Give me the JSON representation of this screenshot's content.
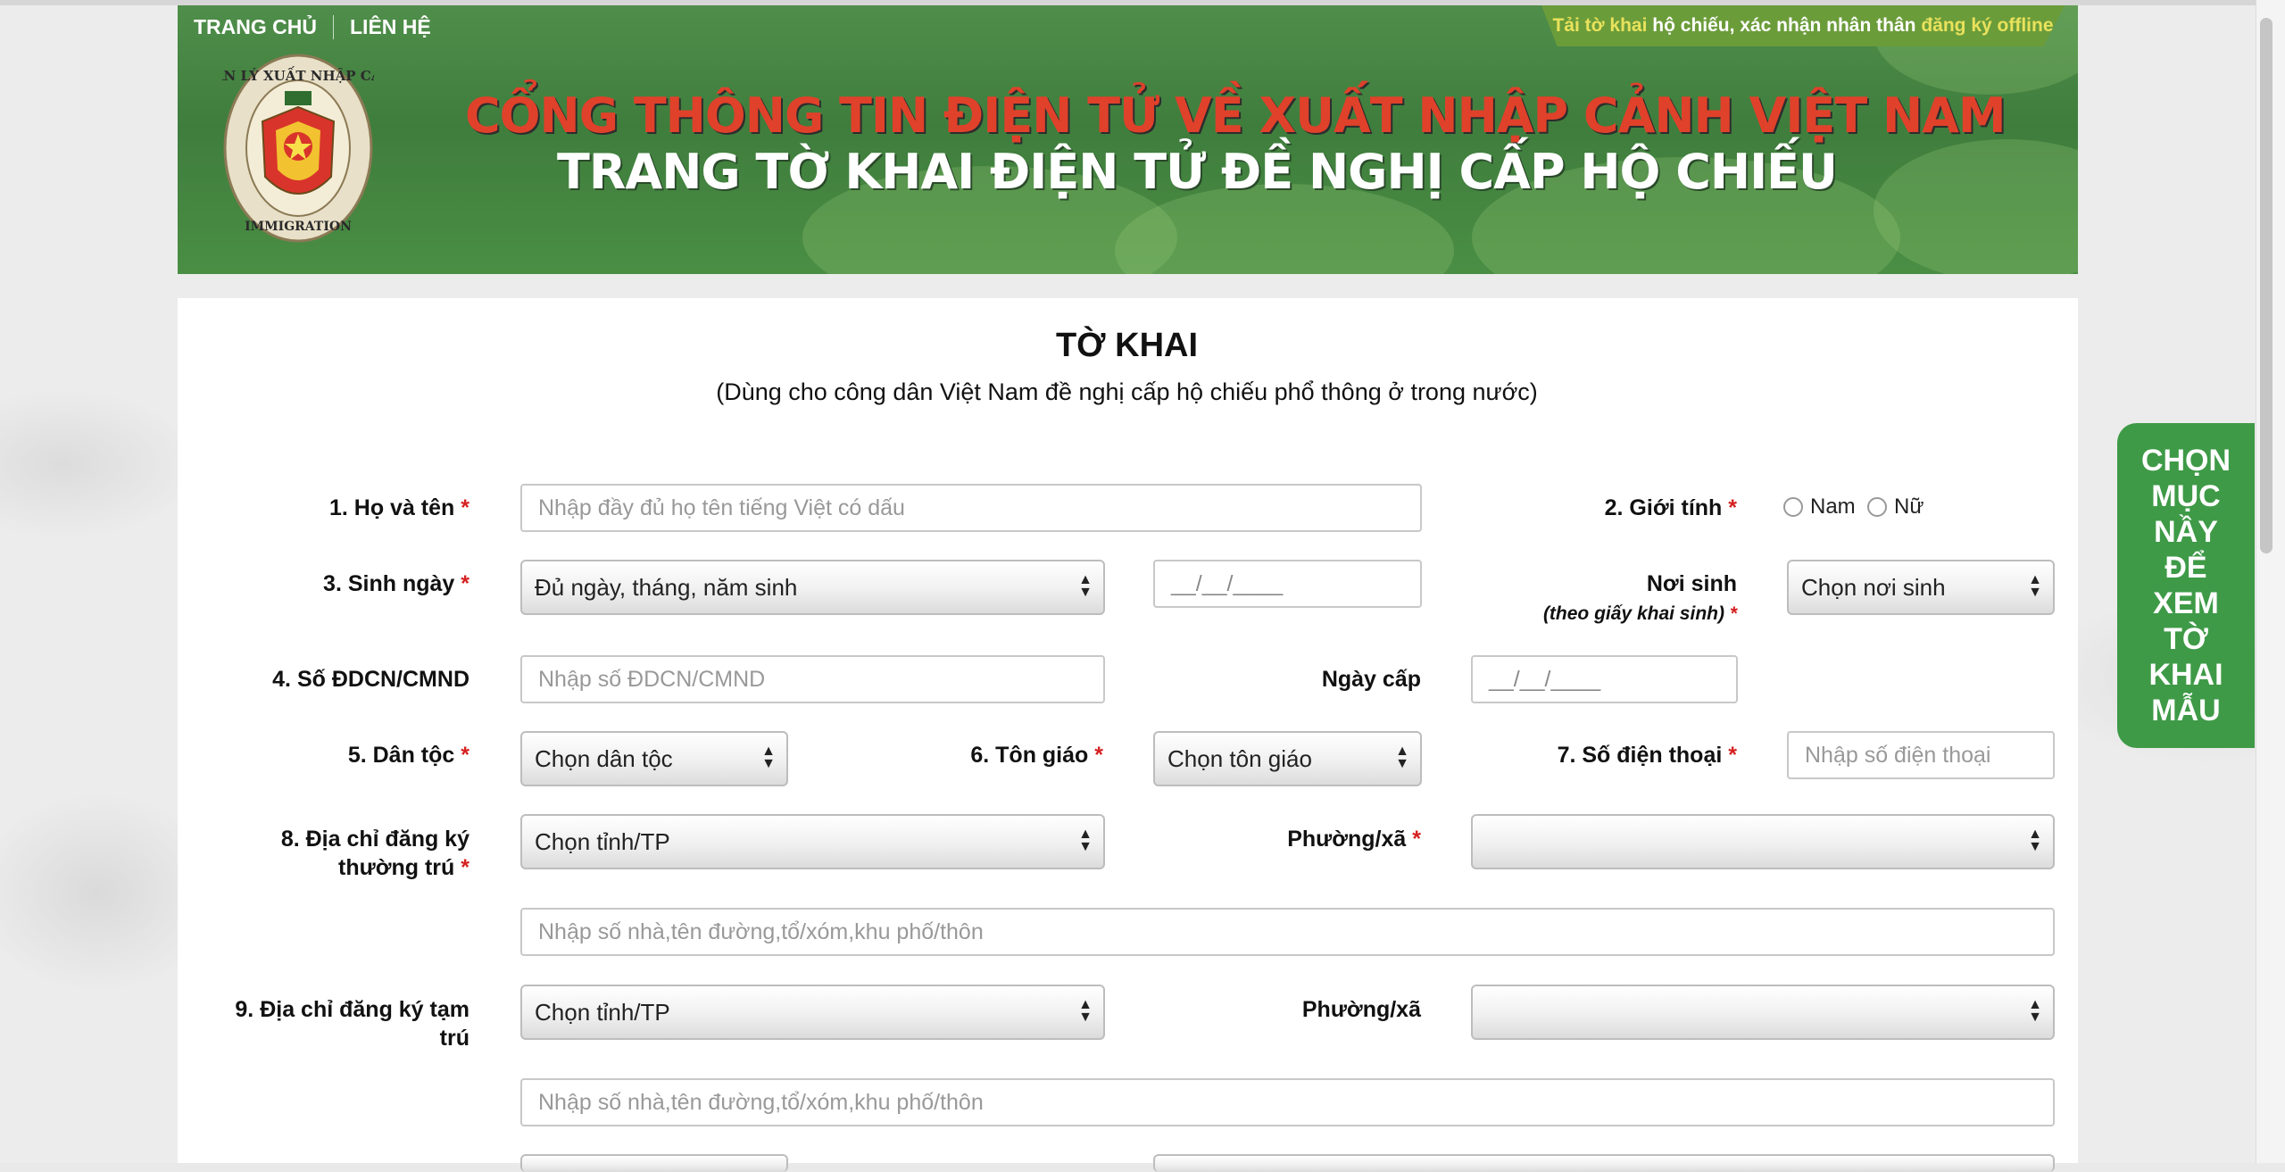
{
  "nav": {
    "home": "TRANG CHỦ",
    "contact": "LIÊN HỆ"
  },
  "notice": {
    "part1": "Tải tờ khai",
    "part2": "hộ chiếu, xác nhận nhân thân",
    "part3": "đăng ký offline"
  },
  "banner": {
    "line1": "CỔNG THÔNG TIN ĐIỆN TỬ VỀ XUẤT NHẬP CẢNH VIỆT NAM",
    "line2": "TRANG TỜ KHAI ĐIỆN TỬ ĐỀ NGHỊ CẤP HỘ CHIẾU",
    "logo_text_top": "QUẢN LÝ XUẤT NHẬP CẢNH",
    "logo_text_bottom": "IMMIGRATION"
  },
  "form": {
    "title": "TỜ KHAI",
    "subtitle": "(Dùng cho công dân Việt Nam đề nghị cấp hộ chiếu phổ thông ở trong nước)",
    "required_mark": "*",
    "full_name": {
      "label": "1. Họ và tên",
      "placeholder": "Nhập đầy đủ họ tên tiếng Việt có dấu"
    },
    "gender": {
      "label": "2. Giới tính",
      "options": [
        "Nam",
        "Nữ"
      ]
    },
    "dob": {
      "label": "3. Sinh ngày",
      "select": "Đủ ngày, tháng, năm sinh",
      "date_mask": "__/__/____"
    },
    "birthplace": {
      "label": "Nơi sinh",
      "sub_label": "(theo giấy khai sinh)",
      "select": "Chọn nơi sinh"
    },
    "id_number": {
      "label": "4. Số ĐDCN/CMND",
      "placeholder": "Nhập số ĐDCN/CMND"
    },
    "issue_date": {
      "label": "Ngày cấp",
      "date_mask": "__/__/____"
    },
    "ethnicity": {
      "label": "5. Dân tộc",
      "select": "Chọn dân tộc"
    },
    "religion": {
      "label": "6. Tôn giáo",
      "select": "Chọn tôn giáo"
    },
    "phone": {
      "label": "7. Số điện thoại",
      "placeholder": "Nhập số điện thoại"
    },
    "permanent_address": {
      "label_line1": "8. Địa chỉ đăng ký",
      "label_line2": "thường trú",
      "province_select": "Chọn tỉnh/TP",
      "ward_label": "Phường/xã",
      "ward_select": "",
      "street_placeholder": "Nhập số nhà,tên đường,tổ/xóm,khu phố/thôn"
    },
    "temporary_address": {
      "label_line1": "9. Địa chỉ đăng ký tạm",
      "label_line2": "trú",
      "province_select": "Chọn tỉnh/TP",
      "ward_label": "Phường/xã",
      "ward_select": "",
      "street_placeholder": "Nhập số nhà,tên đường,tổ/xóm,khu phố/thôn"
    }
  },
  "side_tab": {
    "lines": [
      "CHỌN",
      "MỤC",
      "NẦY",
      "ĐỂ",
      "XEM",
      "TỜ",
      "KHAI",
      "MẪU"
    ]
  },
  "colors": {
    "banner_green": "#4a8a45",
    "title_red": "#e0412a",
    "required_red": "#d62020",
    "side_tab_green": "#3e9a47",
    "notice_yellow": "#e9e25c"
  }
}
